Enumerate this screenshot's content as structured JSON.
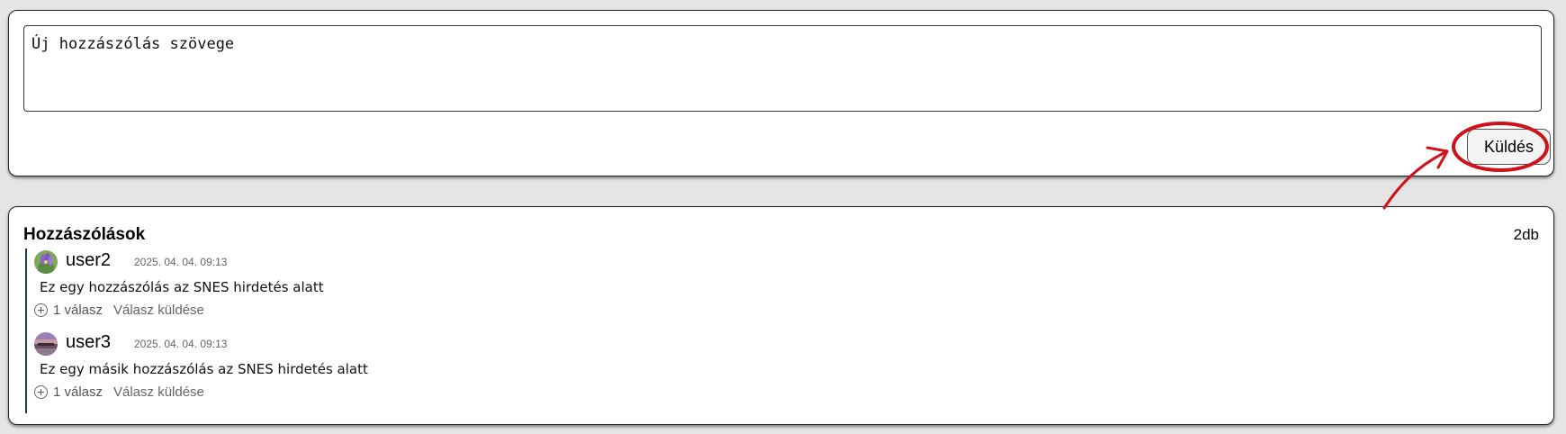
{
  "compose": {
    "placeholder": "Új hozzászólás szövege",
    "send_label": "Küldés"
  },
  "comments": {
    "title": "Hozzászólások",
    "count": "2db",
    "items": [
      {
        "username": "user2",
        "timestamp": "2025. 04. 04. 09:13",
        "text": "Ez egy hozzászólás az SNES hirdetés alatt",
        "reply_count": "1 válasz",
        "reply_action": "Válasz küldése",
        "avatar_icon": "flower-avatar-icon"
      },
      {
        "username": "user3",
        "timestamp": "2025. 04. 04. 09:13",
        "text": "Ez egy másik hozzászólás az SNES hirdetés alatt",
        "reply_count": "1 válasz",
        "reply_action": "Válasz küldése",
        "avatar_icon": "landscape-avatar-icon"
      }
    ]
  },
  "colors": {
    "annotation": "#d0111a",
    "thread_line": "#1e3a4c",
    "page_background": "#e5e5e5"
  }
}
